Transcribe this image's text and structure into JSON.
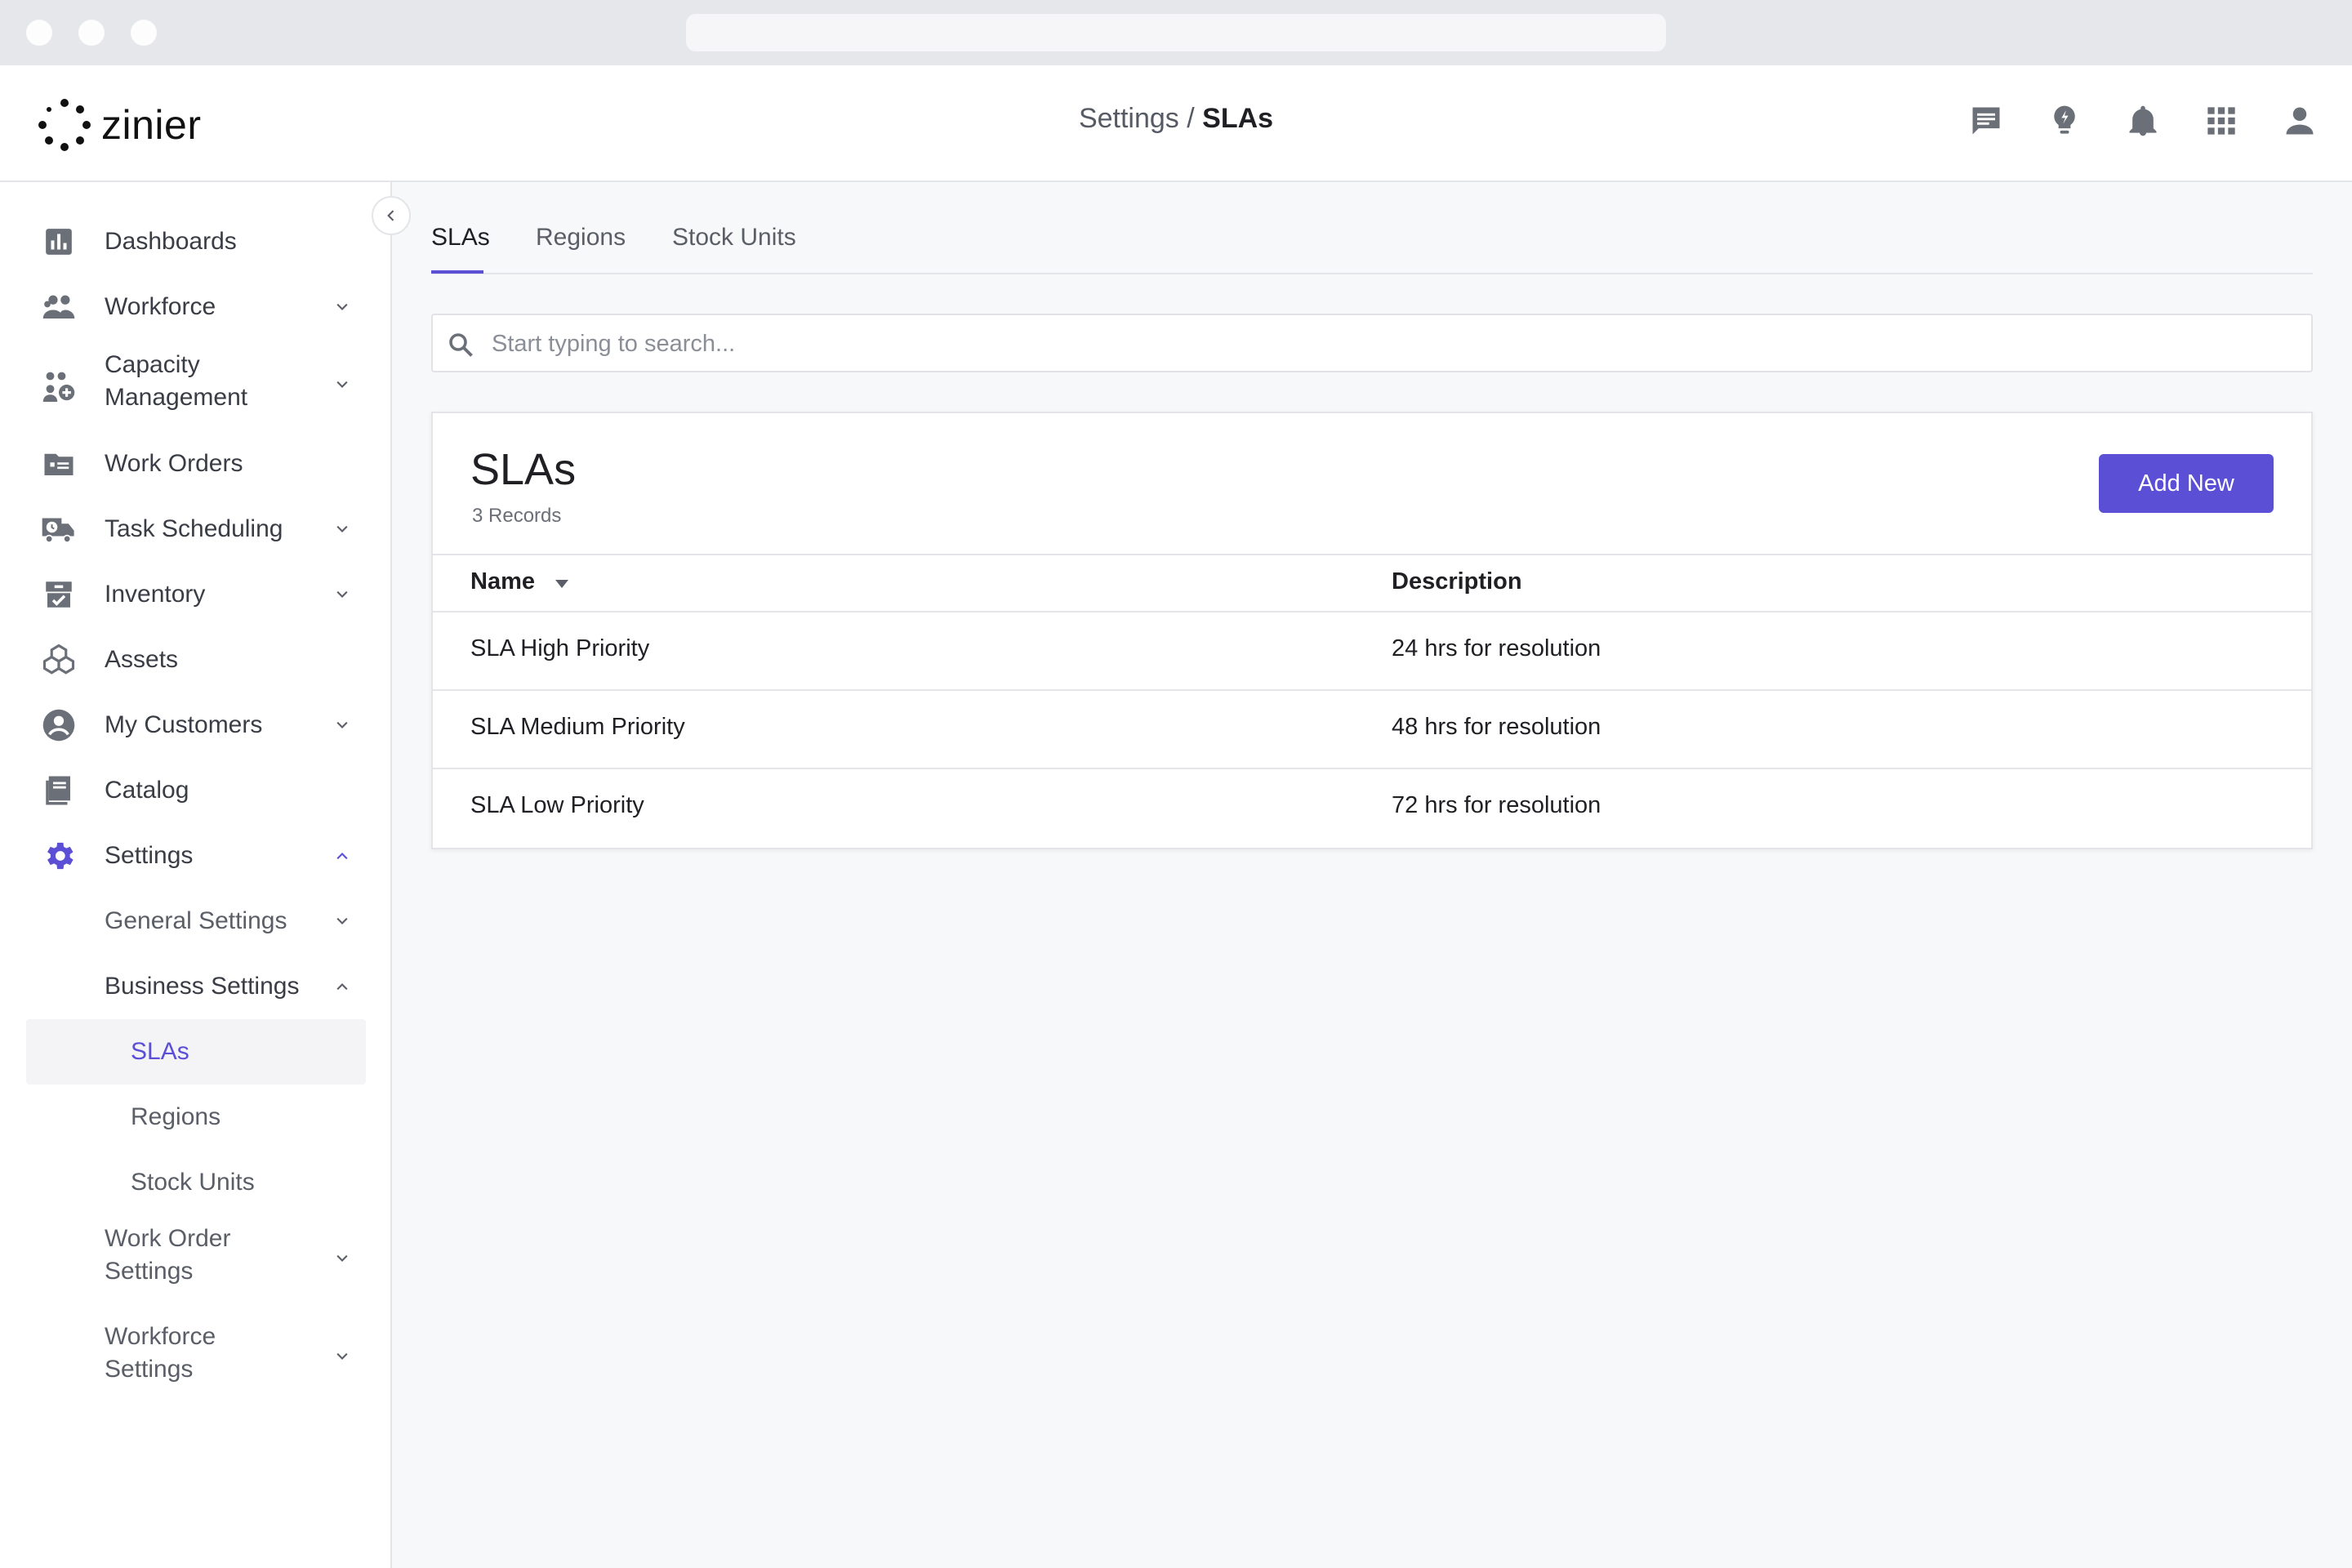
{
  "app": {
    "logo_text": "zinier",
    "breadcrumb_parent": "Settings",
    "breadcrumb_separator": " / ",
    "breadcrumb_current": "SLAs"
  },
  "top_icons": [
    "chat-icon",
    "lightbulb-icon",
    "bell-icon",
    "apps-grid-icon",
    "user-icon"
  ],
  "sidebar": {
    "items": [
      {
        "label": "Dashboards",
        "icon": "bar-chart-icon"
      },
      {
        "label": "Workforce",
        "icon": "people-icon"
      },
      {
        "label": "Capacity",
        "label2": "Management",
        "icon": "capacity-icon"
      },
      {
        "label": "Work Orders",
        "icon": "work-orders-icon"
      },
      {
        "label": "Task Scheduling",
        "icon": "truck-icon"
      },
      {
        "label": "Inventory",
        "icon": "inventory-icon"
      },
      {
        "label": "Assets",
        "icon": "cubes-icon"
      },
      {
        "label": "My Customers",
        "icon": "account-circle-icon"
      },
      {
        "label": "Catalog",
        "icon": "book-icon"
      },
      {
        "label": "Settings",
        "icon": "gear-icon"
      }
    ],
    "sub_items": [
      {
        "label": "General Settings"
      },
      {
        "label": "Business Settings"
      },
      {
        "label": "Work Order",
        "label2": "Settings"
      },
      {
        "label": "Workforce",
        "label2": "Settings"
      }
    ],
    "business_children": [
      "SLAs",
      "Regions",
      "Stock Units"
    ]
  },
  "tabs": [
    "SLAs",
    "Regions",
    "Stock Units"
  ],
  "search": {
    "placeholder": "Start typing to search..."
  },
  "card": {
    "title": "SLAs",
    "subtitle": "3 Records",
    "add_label": "Add New",
    "columns": [
      "Name",
      "Description"
    ],
    "rows": [
      {
        "name": "SLA High Priority",
        "description": "24 hrs for resolution"
      },
      {
        "name": "SLA Medium Priority",
        "description": "48 hrs for resolution"
      },
      {
        "name": "SLA Low Priority",
        "description": "72 hrs for resolution"
      }
    ]
  },
  "colors": {
    "accent": "#5b4fd6",
    "icon_gray": "#6b6f78"
  }
}
